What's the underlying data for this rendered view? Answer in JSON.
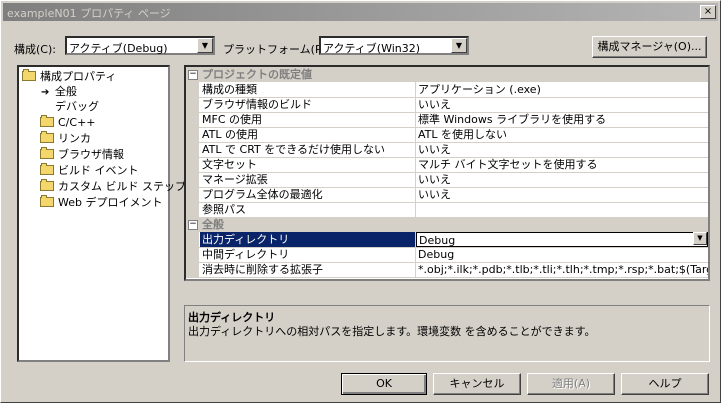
{
  "window": {
    "title": "exampleN01 プロパティ ページ",
    "close": "×"
  },
  "toolbar": {
    "config_label": "構成(C):",
    "config_value": "アクティブ(Debug)",
    "platform_label": "プラットフォーム(P):",
    "platform_value": "アクティブ(Win32)",
    "config_manager": "構成マネージャ(O)..."
  },
  "tree": {
    "root": "構成プロパティ",
    "items": [
      "全般",
      "デバッグ",
      "C/C++",
      "リンカ",
      "ブラウザ情報",
      "ビルド イベント",
      "カスタム ビルド ステップ",
      "Web デプロイメント"
    ]
  },
  "grid": {
    "category1": "プロジェクトの既定値",
    "rows1": [
      {
        "name": "構成の種類",
        "value": "アプリケーション (.exe)"
      },
      {
        "name": "ブラウザ情報のビルド",
        "value": "いいえ"
      },
      {
        "name": "MFC の使用",
        "value": "標準 Windows ライブラリを使用する"
      },
      {
        "name": "ATL の使用",
        "value": "ATL を使用しない"
      },
      {
        "name": "ATL で CRT をできるだけ使用しない",
        "value": "いいえ"
      },
      {
        "name": "文字セット",
        "value": "マルチ バイト文字セットを使用する"
      },
      {
        "name": "マネージ拡張",
        "value": "いいえ"
      },
      {
        "name": "プログラム全体の最適化",
        "value": "いいえ"
      },
      {
        "name": "参照パス",
        "value": ""
      }
    ],
    "category2": "全般",
    "rows2": [
      {
        "name": "出力ディレクトリ",
        "value": "Debug"
      },
      {
        "name": "中間ディレクトリ",
        "value": "Debug"
      },
      {
        "name": "消去時に削除する拡張子",
        "value": "*.obj;*.ilk;*.pdb;*.tlb;*.tli;*.tlh;*.tmp;*.rsp;*.bat;$(TargetPath)"
      }
    ]
  },
  "description": {
    "title": "出力ディレクトリ",
    "text": "出力ディレクトリへの相対パスを指定します。環境変数 を含めることができます。"
  },
  "buttons": {
    "ok": "OK",
    "cancel": "キャンセル",
    "apply": "適用(A)",
    "help": "ヘルプ"
  }
}
